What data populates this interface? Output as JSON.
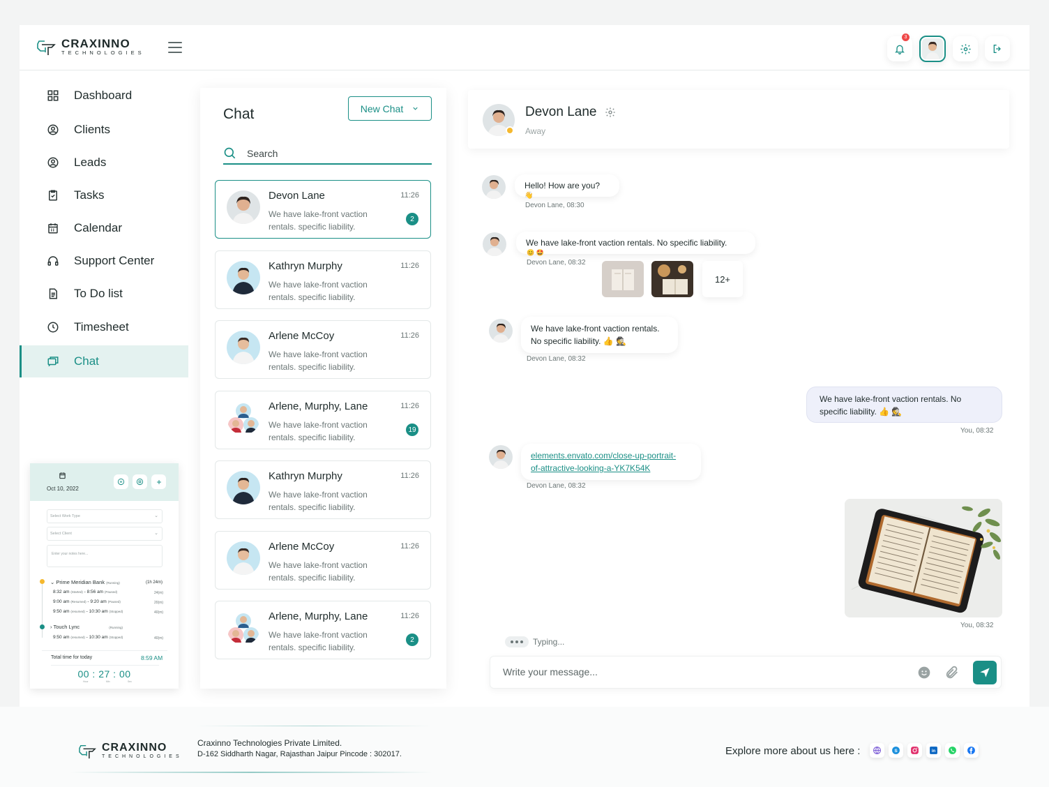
{
  "brand": {
    "name": "CRAXINNO",
    "tagline": "TECHNOLOGIES"
  },
  "header": {
    "notification_count": "3",
    "icons": [
      "bell-icon",
      "user-avatar",
      "gear-icon",
      "logout-icon"
    ]
  },
  "sidebar": {
    "items": [
      {
        "label": "Dashboard",
        "icon": "grid-icon"
      },
      {
        "label": "Clients",
        "icon": "globe-user-icon"
      },
      {
        "label": "Leads",
        "icon": "user-circle-icon"
      },
      {
        "label": "Tasks",
        "icon": "clipboard-check-icon"
      },
      {
        "label": "Calendar",
        "icon": "calendar-icon"
      },
      {
        "label": "Support Center",
        "icon": "headphones-icon"
      },
      {
        "label": "To Do list",
        "icon": "document-icon"
      },
      {
        "label": "Timesheet",
        "icon": "clock-icon"
      },
      {
        "label": "Chat",
        "icon": "chat-icon",
        "active": true
      }
    ]
  },
  "timer": {
    "date": "Oct 10, 2022",
    "work_type_placeholder": "Select Work Type",
    "client_placeholder": "Select Client",
    "notes_placeholder": "Enter your notes here...",
    "entries": [
      {
        "client": "Prime Meridian Bank",
        "status": "(Running)",
        "total": "(1h 24m)"
      },
      {
        "client": "Touch Lync",
        "status": "(Running)",
        "total": ""
      }
    ],
    "logs": [
      {
        "start": "8:32 am",
        "start_tag": "(Started)",
        "end": "8:56 am",
        "end_tag": "(Paused)",
        "dur": "24(m)"
      },
      {
        "start": "9:00 am",
        "start_tag": "(Resumed)",
        "end": "9:20 am",
        "end_tag": "(Paused)",
        "dur": "20(m)"
      },
      {
        "start": "9:50 am",
        "start_tag": "(resumed)",
        "end": "10:30 am",
        "end_tag": "(Stopped)",
        "dur": "40(m)"
      },
      {
        "start": "9:50 am",
        "start_tag": "(resumed)",
        "end": "10:30 am",
        "end_tag": "(Stopped)",
        "dur": "40(m)"
      }
    ],
    "total_label": "Total time for today",
    "total_time": "8:59 AM",
    "clock": "00 : 27 : 00",
    "clock_units": [
      "Hour",
      "Min",
      "Sec"
    ]
  },
  "chat_list": {
    "title": "Chat",
    "new_chat_label": "New Chat",
    "search_placeholder": "Search",
    "conversations": [
      {
        "name": "Devon Lane",
        "time": "11:26",
        "preview": "We have lake-front vaction rentals. specific liability.",
        "unread": "2",
        "active": true
      },
      {
        "name": "Kathryn Murphy",
        "time": "11:26",
        "preview": "We have lake-front vaction rentals. specific liability.",
        "unread": ""
      },
      {
        "name": "Arlene McCoy",
        "time": "11:26",
        "preview": "We have lake-front vaction rentals. specific liability.",
        "unread": ""
      },
      {
        "name": "Arlene, Murphy, Lane",
        "time": "11:26",
        "preview": "We have lake-front vaction rentals. specific liability.",
        "unread": "19"
      },
      {
        "name": "Kathryn Murphy",
        "time": "11:26",
        "preview": "We have lake-front vaction rentals. specific liability.",
        "unread": ""
      },
      {
        "name": "Arlene McCoy",
        "time": "11:26",
        "preview": "We have lake-front vaction rentals. specific liability.",
        "unread": ""
      },
      {
        "name": "Arlene, Murphy, Lane",
        "time": "11:26",
        "preview": "We have lake-front vaction rentals. specific liability.",
        "unread": "2"
      }
    ]
  },
  "conversation": {
    "contact_name": "Devon Lane",
    "contact_status": "Away",
    "messages": [
      {
        "text": "Hello! How are you?",
        "emoji": "👋",
        "meta": "Devon Lane, 08:30"
      },
      {
        "text": "We have lake-front vaction rentals. No specific liability.",
        "emoji": "😊 🤩",
        "meta": "Devon Lane, 08:32",
        "more": "12+"
      },
      {
        "text_line1": "We have lake-front vaction rentals.",
        "text_line2": "No specific liability. 👍 🕵",
        "meta": "Devon Lane, 08:32"
      },
      {
        "text_line1": "We have lake-front vaction rentals. No",
        "text_line2": "specific liability. 👍 🕵",
        "meta": "You, 08:32"
      },
      {
        "link_line1": "elements.envato.com/close-up-portrait-",
        "link_line2": "of-attractive-looking-a-YK7K54K",
        "meta": "Devon Lane, 08:32"
      },
      {
        "meta": "You, 08:32"
      }
    ],
    "typing_label": "Typing...",
    "composer_placeholder": "Write your message..."
  },
  "footer": {
    "company": "Craxinno Technologies Private Limited.",
    "address": "D-162 Siddharth Nagar, Rajasthan Jaipur Pincode : 302017.",
    "explore": "Explore more about us here :",
    "social": [
      "globe-icon",
      "skype-icon",
      "instagram-icon",
      "linkedin-icon",
      "whatsapp-icon",
      "facebook-icon"
    ]
  },
  "colors": {
    "accent": "#1a8f86",
    "status_away": "#f5b82e",
    "badge": "#ef4848"
  }
}
